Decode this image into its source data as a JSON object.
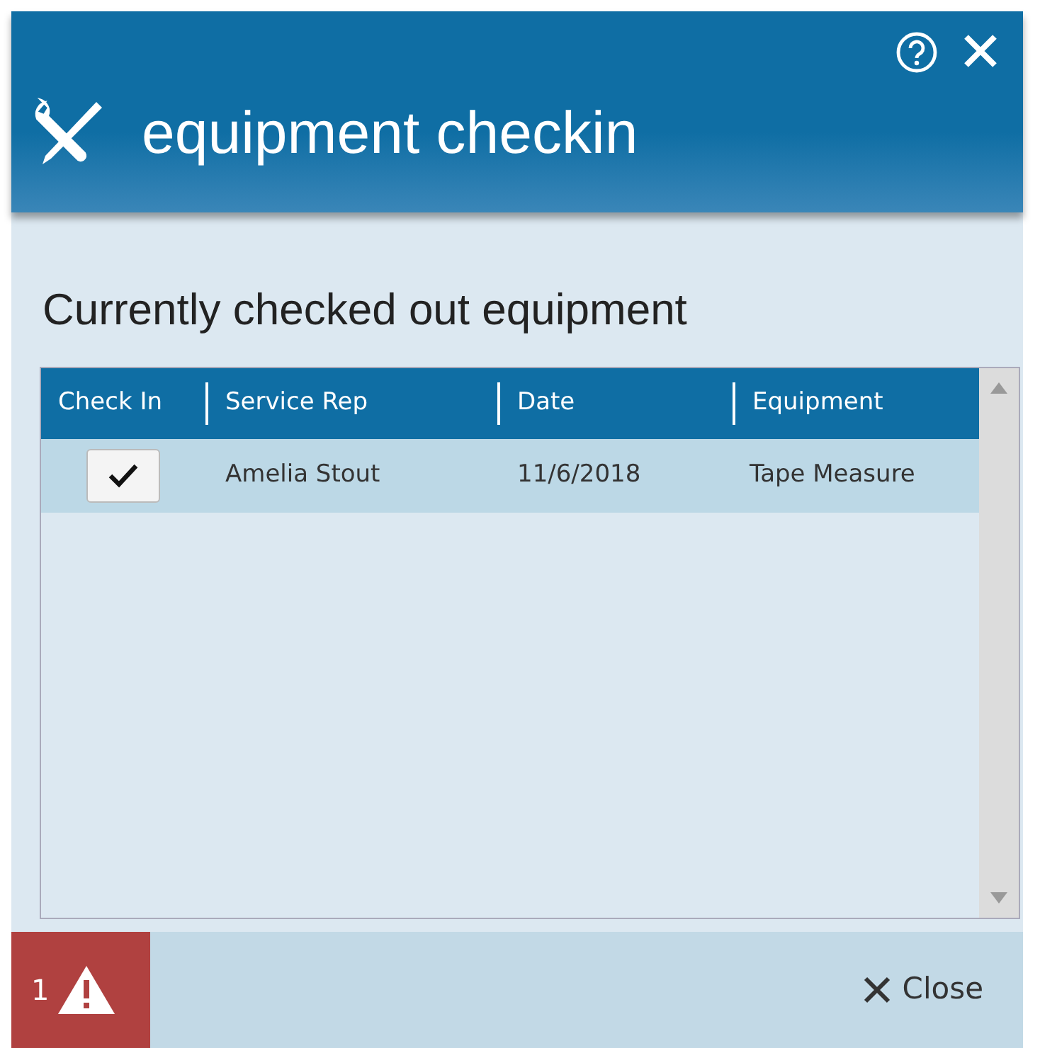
{
  "window": {
    "title": "equipment checkin"
  },
  "section_title": "Currently checked out equipment",
  "table": {
    "columns": [
      "Check In",
      "Service Rep",
      "Date",
      "Equipment"
    ],
    "rows": [
      {
        "checked": true,
        "selected": true,
        "cells": [
          "",
          "Amelia Stout",
          "11/6/2018",
          "Tape Measure"
        ]
      }
    ]
  },
  "footer": {
    "alert_count": "1",
    "close_label": "Close"
  }
}
